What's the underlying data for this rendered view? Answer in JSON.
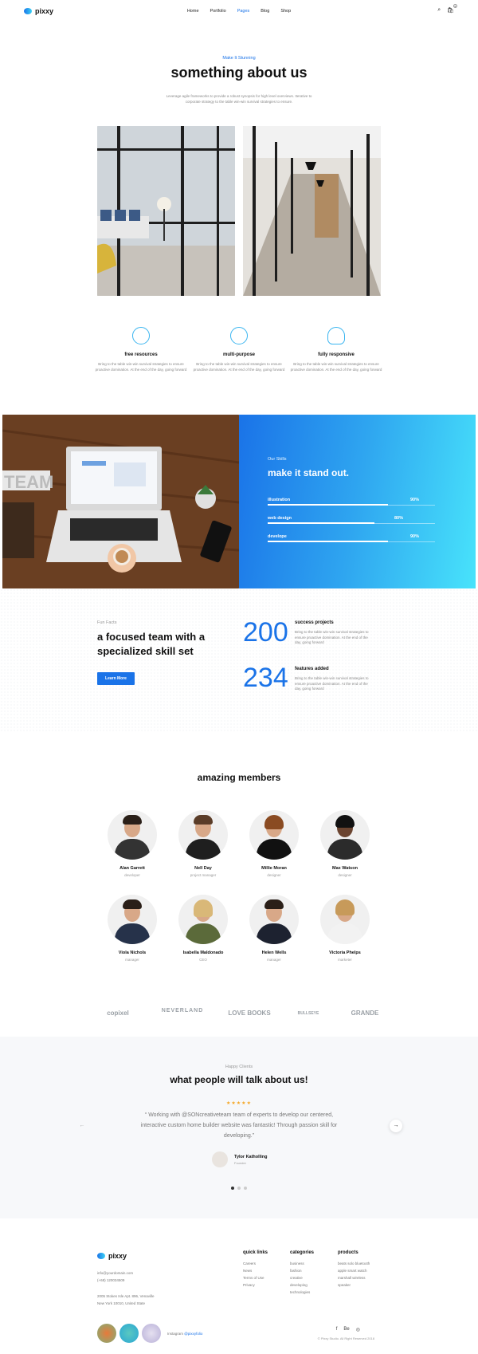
{
  "header": {
    "logo": "pixxy",
    "nav": [
      "Home",
      "Portfolio",
      "Pages",
      "Blog",
      "Shop"
    ],
    "active_nav": "Pages",
    "cart_count": "0"
  },
  "about": {
    "eyebrow": "Make It Stunning",
    "title": "something about us",
    "intro": "Leverage agile frameworks to provide a robust synopsis for high level overviews. Iterative to corporate strategy to the table win-win survival strategies to ensure."
  },
  "features": [
    {
      "icon": "gauge-icon",
      "title": "free resources",
      "desc": "Bring to the table win-win survival strategies to ensure proactive domination. At the end of the day, going forward"
    },
    {
      "icon": "lifebuoy-icon",
      "title": "multi-purpose",
      "desc": "Bring to the table win-win survival strategies to ensure proactive domination. At the end of the day, going forward"
    },
    {
      "icon": "lightbulb-icon",
      "title": "fully responsive",
      "desc": "Bring to the table win-win survival strategies to ensure proactive domination. At the end of the day, going forward"
    }
  ],
  "skills": {
    "eyebrow": "Our Skills",
    "title": "make it stand out.",
    "items": [
      {
        "label": "illustration",
        "percent_text": "90%",
        "value": 90
      },
      {
        "label": "web design",
        "percent_text": "80%",
        "value": 80
      },
      {
        "label": "develope",
        "percent_text": "90%",
        "value": 90
      }
    ]
  },
  "facts": {
    "eyebrow": "Fun Facts",
    "title": "a focused team with a specialized skill set",
    "button": "Learn More",
    "stats": [
      {
        "number": "200",
        "title": "success projects",
        "desc": "Bring to the table win-win survival strategies to ensure proactive domination. At the end of the day, going forward"
      },
      {
        "number": "234",
        "title": "features added",
        "desc": "Bring to the table win-win survival strategies to ensure proactive domination. At the end of the day, going forward"
      }
    ]
  },
  "members": {
    "title": "amazing members",
    "people": [
      {
        "name": "Alan Garrett",
        "role": "developer"
      },
      {
        "name": "Nell Day",
        "role": "project manager"
      },
      {
        "name": "Millie Moran",
        "role": "designer"
      },
      {
        "name": "Max Watson",
        "role": "designer"
      },
      {
        "name": "Viola Nichols",
        "role": "manager"
      },
      {
        "name": "Isabella Maldonado",
        "role": "CEO"
      },
      {
        "name": "Helen Wells",
        "role": "manager"
      },
      {
        "name": "Victoria Phelps",
        "role": "marketer"
      }
    ]
  },
  "brands": [
    "copixel",
    "NEVERLAND",
    "LOVE BOOKS",
    "BULLSEYE",
    "GRANDE"
  ],
  "testimonials": {
    "eyebrow": "Happy Clients",
    "title": "what people will talk about us!",
    "stars": "★★★★★",
    "quote": "“ Working with @SONcreativeteam team of experts to develop our centered, interactive custom home builder website was fantastic! Through passion skill for developing.”",
    "author": "Tylor Katholling",
    "author_role": "Founder"
  },
  "footer": {
    "logo": "pixxy",
    "email": "info@yourdomain.com",
    "phone": "(+68) 120034509",
    "address1": "2005 Stokes Isle Apt. 896, Venaville",
    "address2": "New York 10010, United State",
    "instagram_label": "Instagram",
    "instagram_handle": "@pixxyfolio",
    "columns": [
      {
        "title": "quick links",
        "links": [
          "Careers",
          "News",
          "Terms of Use",
          "Privacy"
        ]
      },
      {
        "title": "categories",
        "links": [
          "business",
          "fashion",
          "creative",
          "developing",
          "technologies"
        ]
      },
      {
        "title": "products",
        "links": [
          "beats solo bluetooth",
          "apple smart watch",
          "marshall wireless",
          "speaker"
        ]
      }
    ],
    "social": [
      "f",
      "Be",
      "◎"
    ],
    "copyright": "© Pixxy Studio. All Right Reserved 2018"
  },
  "colors": {
    "accent": "#1a73e8",
    "gradient_end": "#48e3fb",
    "stars": "#f5a623"
  }
}
